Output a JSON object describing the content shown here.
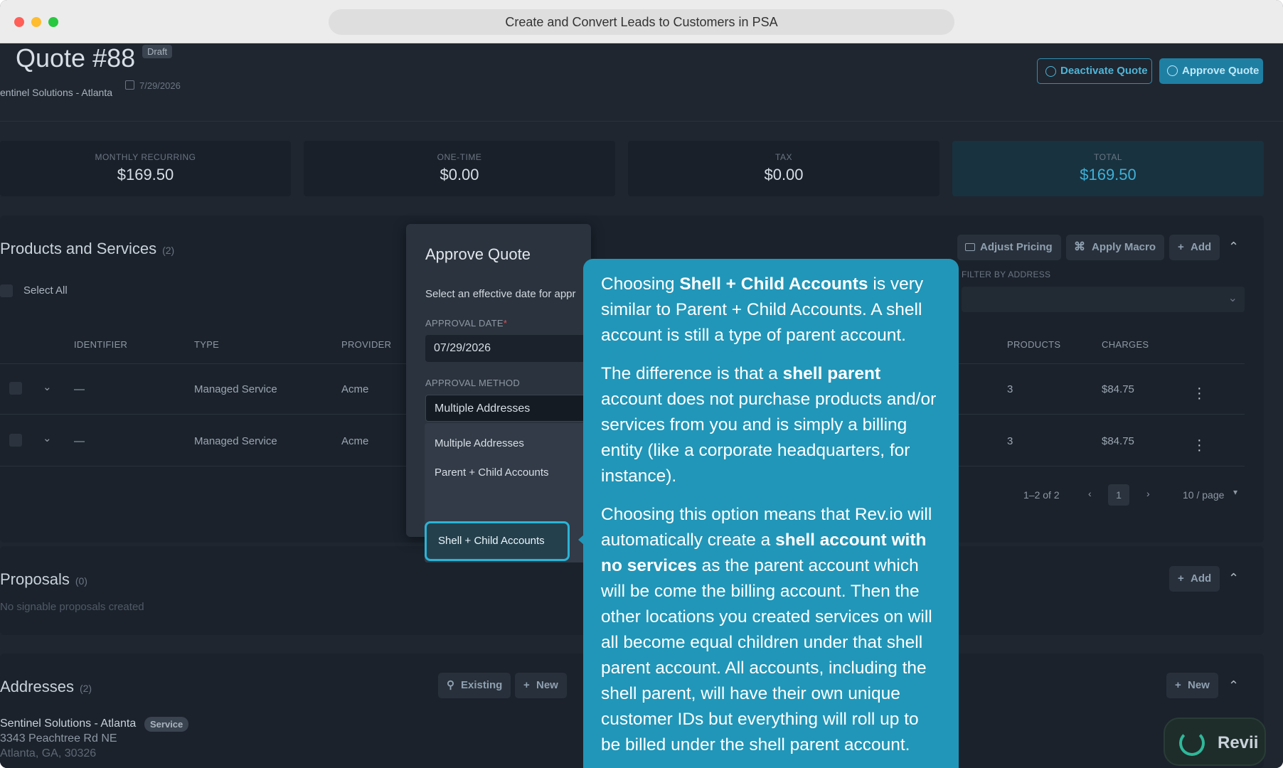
{
  "window": {
    "title": "Create and Convert Leads to Customers in PSA"
  },
  "header": {
    "quote_title": "Quote #88",
    "status_badge": "Draft",
    "account_name": "entinel Solutions - Atlanta",
    "date": "7/29/2026",
    "deactivate_label": "Deactivate Quote",
    "approve_label": "Approve Quote"
  },
  "summary": [
    {
      "label": "MONTHLY RECURRING",
      "value": "$169.50"
    },
    {
      "label": "ONE-TIME",
      "value": "$0.00"
    },
    {
      "label": "TAX",
      "value": "$0.00"
    },
    {
      "label": "TOTAL",
      "value": "$169.50"
    }
  ],
  "products": {
    "title": "Products and Services",
    "count": "(2)",
    "select_all": "Select All",
    "adjust_pricing": "Adjust Pricing",
    "apply_macro": "Apply Macro",
    "add": "Add",
    "filter_label": "FILTER BY ADDRESS",
    "columns": [
      "IDENTIFIER",
      "TYPE",
      "PROVIDER",
      "PRODUCTS",
      "CHARGES"
    ],
    "rows": [
      {
        "identifier": "—",
        "type": "Managed Service",
        "provider": "Acme",
        "products": "3",
        "charges": "$84.75"
      },
      {
        "identifier": "—",
        "type": "Managed Service",
        "provider": "Acme",
        "products": "3",
        "charges": "$84.75"
      }
    ],
    "pager": {
      "range": "1–2 of 2",
      "page": "1",
      "per_page": "10 / page"
    }
  },
  "proposals": {
    "title": "Proposals",
    "count": "(0)",
    "empty": "No signable proposals created",
    "add": "Add"
  },
  "addresses": {
    "title": "Addresses",
    "count": "(2)",
    "existing": "Existing",
    "new": "New",
    "name": "Sentinel Solutions - Atlanta",
    "badge": "Service",
    "street": "3343 Peachtree Rd NE",
    "city": "Atlanta, GA, 30326"
  },
  "modal": {
    "title": "Approve Quote",
    "description": "Select an effective date for appr",
    "date_label": "APPROVAL DATE",
    "date_value": "07/29/2026",
    "method_label": "APPROVAL METHOD",
    "method_value": "Multiple Addresses",
    "options": [
      "Multiple Addresses",
      "Parent + Child Accounts",
      "Shell + Child Accounts"
    ]
  },
  "tooltip": {
    "p1_a": "Choosing ",
    "p1_b": "Shell + Child Accounts",
    "p1_c": " is very similar to Parent + Child Accounts. A shell account is still a type of parent account.",
    "p2_a": "The difference is that a ",
    "p2_b": "shell parent",
    "p2_c": " account does not purchase products and/or services from you and is simply a billing entity (like a corporate headquarters, for instance).",
    "p3_a": "Choosing this option means that Rev.io will automatically create a ",
    "p3_b": "shell account with no services",
    "p3_c": " as the parent account which will be come the billing account. Then the other locations you created services on will all become equal children under that shell parent account. All accounts, including the shell parent, will have their own unique customer IDs but everything will roll up to be billed under the shell parent account."
  },
  "assistant": {
    "label": "Revii"
  },
  "colors": {
    "accent": "#2196b8",
    "background": "#1f2630",
    "total": "#3fb0d8"
  }
}
